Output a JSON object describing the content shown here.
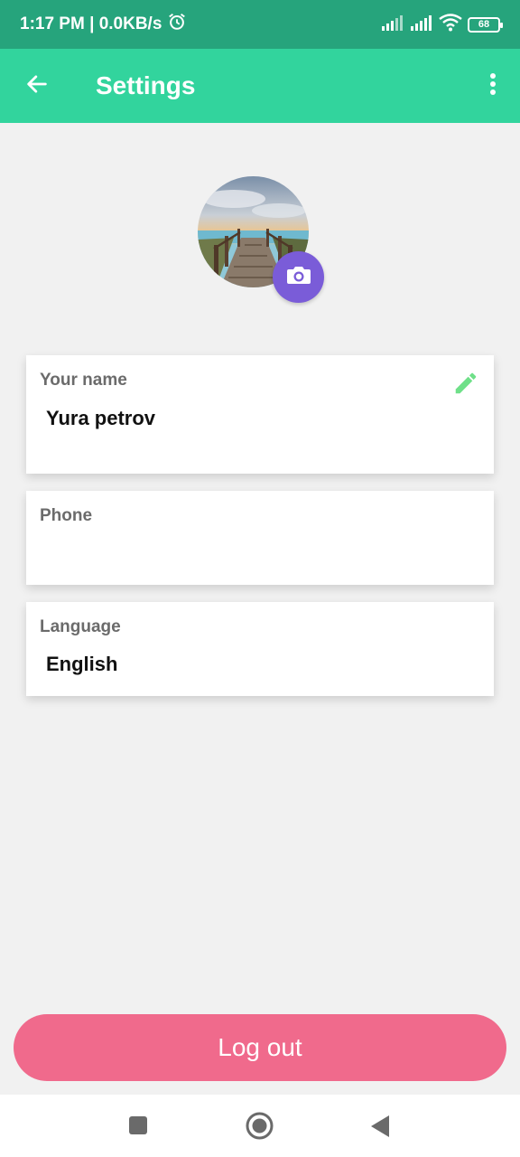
{
  "status_bar": {
    "time": "1:17 PM",
    "speed": "0.0KB/s",
    "battery": "68"
  },
  "app_bar": {
    "title": "Settings"
  },
  "profile": {
    "name_label": "Your name",
    "name_value": "Yura petrov",
    "phone_label": "Phone",
    "phone_value": "",
    "language_label": "Language",
    "language_value": "English"
  },
  "actions": {
    "logout_label": "Log out"
  },
  "colors": {
    "status_bar": "#26a47c",
    "app_bar": "#32d49d",
    "camera_button": "#7a5cd8",
    "edit_icon": "#6fe089",
    "logout_button": "#f06a8c"
  },
  "icons": {
    "back": "arrow-left-icon",
    "more": "more-vertical-icon",
    "camera": "camera-icon",
    "edit": "pencil-icon",
    "nav_recent": "square-icon",
    "nav_home": "circle-icon",
    "nav_back": "triangle-back-icon"
  }
}
